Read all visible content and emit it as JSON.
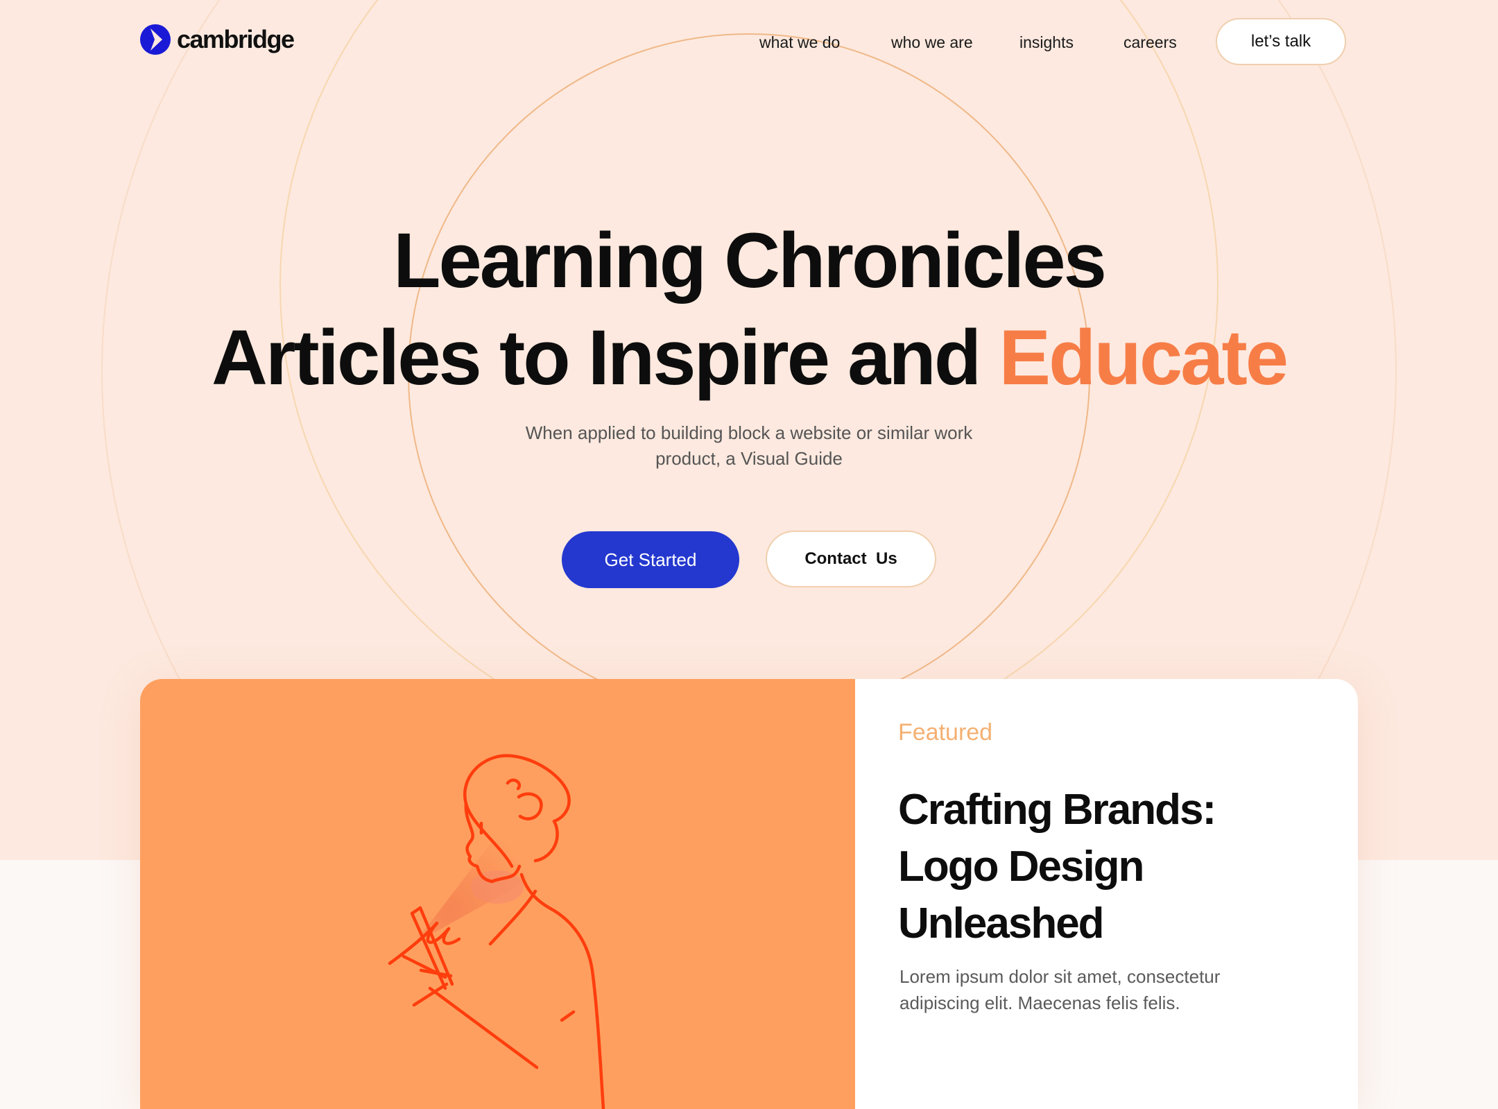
{
  "brand": {
    "name": "cambridge",
    "color": "#1a1ad6"
  },
  "nav": {
    "links": [
      "what we do",
      "who we are",
      "insights",
      "careers"
    ],
    "cta_label": "let’s talk"
  },
  "hero": {
    "title_line1": "Learning Chronicles",
    "title_line2_main": "Articles to Inspire and ",
    "title_line2_accent": "Educate",
    "subtitle": "When applied to building block a website or similar work product, a Visual Guide",
    "primary_button": "Get Started",
    "secondary_button": "Contact  Us"
  },
  "featured": {
    "label": "Featured",
    "title": "Crafting Brands: Logo Design Unleashed",
    "excerpt": "Lorem ipsum dolor sit amet, consectetur adipiscing elit. Maecenas felis felis.",
    "illustration_icon": "person-with-phone-illustration"
  },
  "colors": {
    "hero_background": "#fde9df",
    "accent_orange": "#f77d47",
    "primary_blue": "#2438cf",
    "featured_label": "#f4b072",
    "illustration_background": "#fe9f5f",
    "illustration_stroke": "#ff3d0d"
  }
}
